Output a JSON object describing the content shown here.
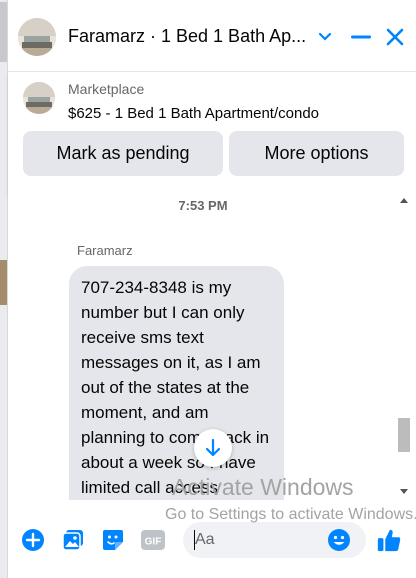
{
  "header": {
    "title": "Faramarz · 1 Bed 1 Bath Ap...",
    "icons": [
      "chevron-down-icon",
      "minimize-icon",
      "close-icon"
    ]
  },
  "marketplace": {
    "label": "Marketplace",
    "subtitle": "$625 - 1 Bed 1 Bath Apartment/condo",
    "buttons": {
      "mark_pending": "Mark as pending",
      "more_options": "More options"
    }
  },
  "chat": {
    "timestamp": "7:53 PM",
    "sender": "Faramarz",
    "message": "707-234-8348 is my number but I can only receive sms text messages on it, as I am out of the states at the moment, and am planning to come back in about a week so I have limited call access"
  },
  "watermark": {
    "line1": "Activate Windows",
    "line2": "Go to Settings to activate Windows."
  },
  "composer": {
    "placeholder": "Aa",
    "icons": [
      "plus-icon",
      "photo-icon",
      "sticker-icon",
      "gif-icon",
      "emoji-icon",
      "like-icon"
    ]
  },
  "colors": {
    "accent": "#0084ff",
    "bubble": "#e4e6eb",
    "muted": "#65676b"
  }
}
